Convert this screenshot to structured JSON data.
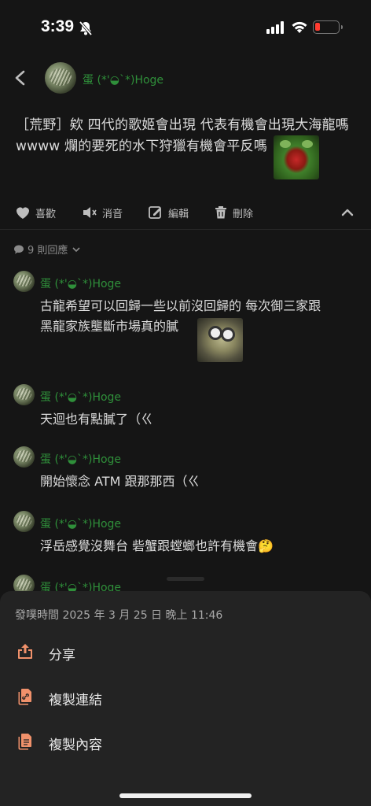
{
  "status_bar": {
    "time": "3:39"
  },
  "post": {
    "author": "蛋 (*'◒`*)Hoge",
    "text_line1": "［荒野］欸 四代的歌姬會出現 代表有機會出現大海龍嗎",
    "text_line2": "wwww 爛的要死的水下狩獵有機會平反嗎"
  },
  "actions": {
    "like": "喜歡",
    "mute": "消音",
    "edit": "編輯",
    "delete": "刪除"
  },
  "replies": {
    "count_label": "9 則回應",
    "items": [
      {
        "author": "蛋 (*'◒`*)Hoge",
        "line1": "古龍希望可以回歸一些以前沒回歸的 每次御三家跟",
        "line2": "黑龍家族壟斷市場真的膩"
      },
      {
        "author": "蛋 (*'◒`*)Hoge",
        "line1": "天迴也有點膩了（ㄍ"
      },
      {
        "author": "蛋 (*'◒`*)Hoge",
        "line1": "開始懷念 ATM 跟那那西（ㄍ"
      },
      {
        "author": "蛋 (*'◒`*)Hoge",
        "line1": "浮岳感覺沒舞台 砦蟹跟螳螂也許有機會🤔"
      },
      {
        "author": "蛋 (*'◒`*)Hoge"
      }
    ]
  },
  "sheet": {
    "post_time": "發噗時間 2025 年 3 月 25 日 晚上 11:46",
    "share": "分享",
    "copy_link": "複製連結",
    "copy_content": "複製內容"
  },
  "colors": {
    "background": "#151515",
    "username": "#2f8f3a",
    "accent_icon": "#f0916b",
    "sheet": "#232323"
  }
}
